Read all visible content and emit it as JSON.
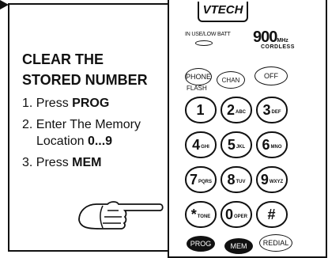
{
  "instructions": {
    "title_line1": "CLEAR THE",
    "title_line2": "STORED NUMBER",
    "step1_prefix": "1. Press ",
    "step1_key": "PROG",
    "step2_prefix": "2. Enter The Memory",
    "step2_cont": "Location ",
    "step2_range": "0...9",
    "step3_prefix": "3. Press ",
    "step3_key": "MEM"
  },
  "icons": [
    "arrow-right-icon",
    "pointing-hand-icon"
  ],
  "phone": {
    "brand": "VTECH",
    "in_use_label": "IN USE/LOW BATT",
    "freq_value": "900",
    "freq_unit": "MHz",
    "cordless_label": "CORDLESS",
    "phone_key": "PHONE",
    "flash_label": "FLASH",
    "chan_key": "CHAN",
    "off_key": "OFF",
    "keys": [
      {
        "digit": "1",
        "letters": ""
      },
      {
        "digit": "2",
        "letters": "ABC"
      },
      {
        "digit": "3",
        "letters": "DEF"
      },
      {
        "digit": "4",
        "letters": "GHI"
      },
      {
        "digit": "5",
        "letters": "JKL"
      },
      {
        "digit": "6",
        "letters": "MNO"
      },
      {
        "digit": "7",
        "letters": "PQRS"
      },
      {
        "digit": "8",
        "letters": "TUV"
      },
      {
        "digit": "9",
        "letters": "WXYZ"
      },
      {
        "digit": "*",
        "letters": "TONE"
      },
      {
        "digit": "0",
        "letters": "OPER"
      },
      {
        "digit": "#",
        "letters": ""
      }
    ],
    "prog_key": "PROG",
    "mem_key": "MEM",
    "redial_key": "REDIAL"
  }
}
